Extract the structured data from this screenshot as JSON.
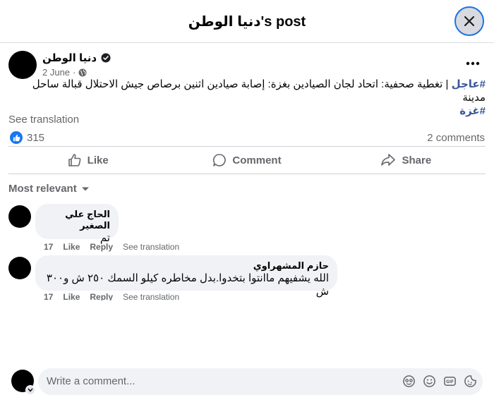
{
  "header": {
    "title": "دنيا الوطن's post"
  },
  "post": {
    "author": "دنيا الوطن",
    "date": "2 June",
    "date_sep": "·",
    "text_hashtag1": "#عاجل",
    "text_body": " | تغطية صحفية: اتحاد لجان الصيادين بغزة: إصابة صيادين اثنين برصاص جيش الاحتلال قبالة ساحل مدينة",
    "text_hashtag2": "#غزة",
    "see_translation": "See translation",
    "reactions_count": "315",
    "comments_count": "2 comments"
  },
  "actions": {
    "like": "Like",
    "comment": "Comment",
    "share": "Share"
  },
  "sort": {
    "label": "Most relevant"
  },
  "comments": [
    {
      "author": "الحاج علي الصغير",
      "text": "تم",
      "time": "17",
      "like": "Like",
      "reply": "Reply",
      "translate": "See translation"
    },
    {
      "author": "حازم المشهراوي",
      "text": "الله يشفيهم ماانتوا بتخدوا.بدل مخاطره كيلو السمك ٢٥٠ ش و٣٠٠ ش",
      "time": "17",
      "like": "Like",
      "reply": "Reply",
      "translate": "See translation"
    }
  ],
  "composer": {
    "placeholder": "Write a comment..."
  },
  "icons": [
    "close-icon",
    "verified-badge-icon",
    "globe-icon",
    "more-icon",
    "like-reaction-icon",
    "thumbs-up-icon",
    "comment-icon",
    "share-icon",
    "chevron-down-icon",
    "avatar-sticker-icon",
    "emoji-icon",
    "gif-icon",
    "sticker-icon"
  ],
  "colors": {
    "accent": "#1877f2",
    "hashtag": "#385898",
    "muted": "#65676b",
    "bubble": "#f0f2f5"
  }
}
